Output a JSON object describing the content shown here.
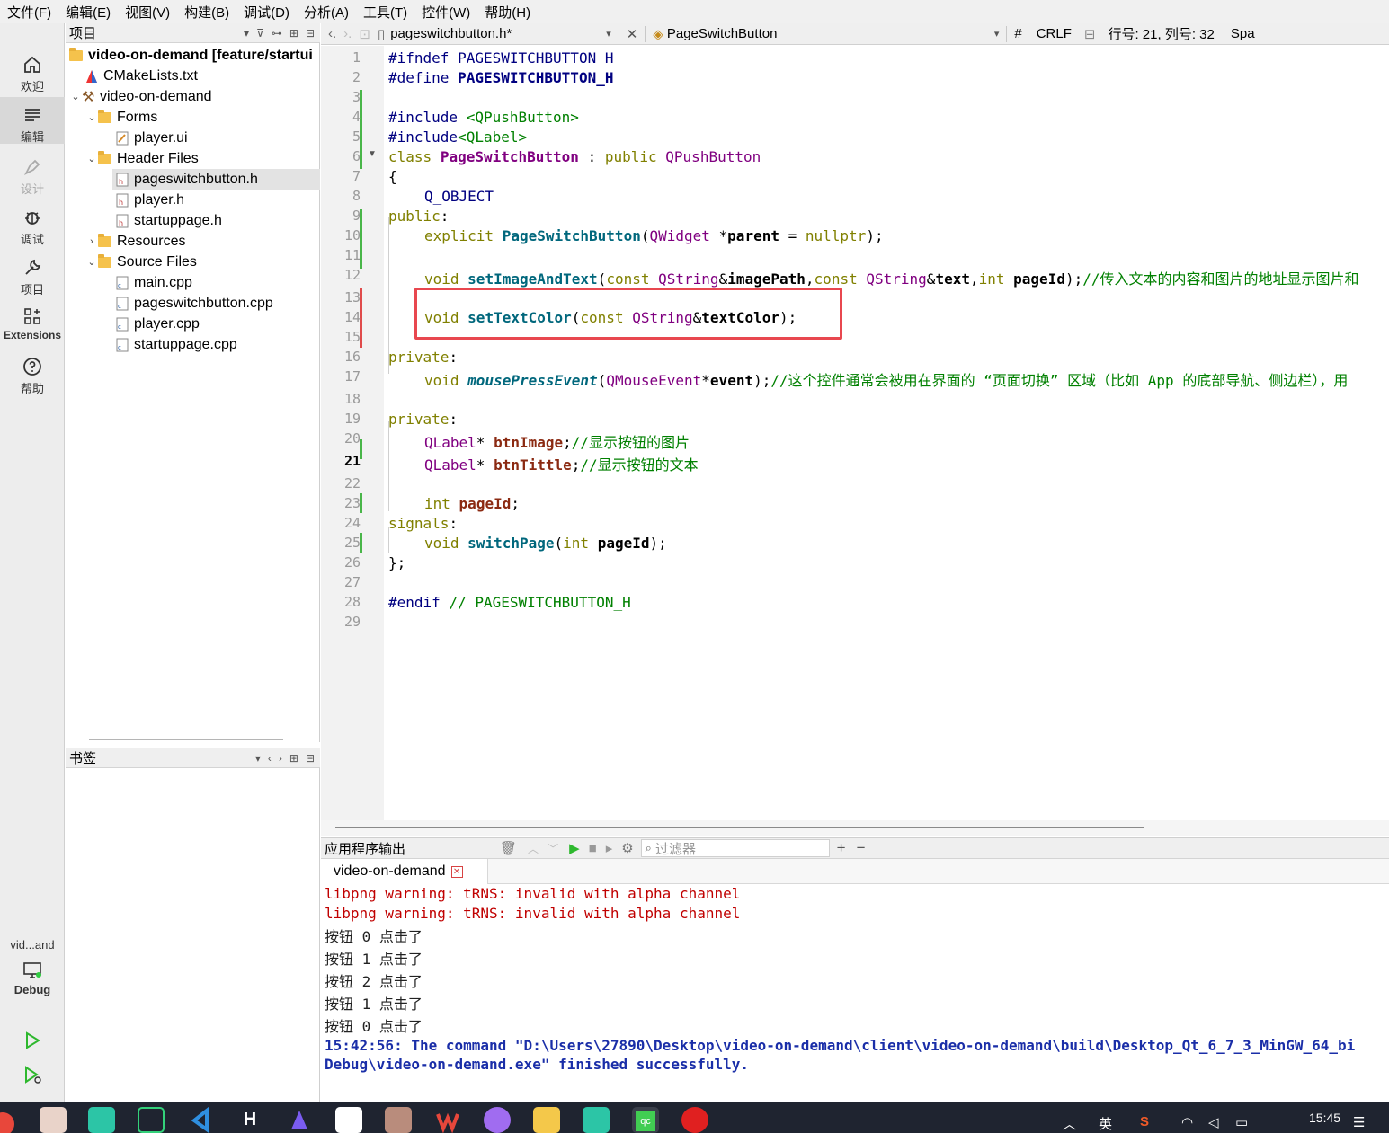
{
  "menu": [
    "文件(F)",
    "编辑(E)",
    "视图(V)",
    "构建(B)",
    "调试(D)",
    "分析(A)",
    "工具(T)",
    "控件(W)",
    "帮助(H)"
  ],
  "modes": {
    "welcome": "欢迎",
    "edit": "编辑",
    "design": "设计",
    "debug": "调试",
    "project": "项目",
    "extensions": "Extensions",
    "help": "帮助",
    "target_name": "vid...and",
    "target_config": "Debug"
  },
  "project_panel": {
    "title": "项目",
    "tree": [
      {
        "label": "video-on-demand [feature/startui",
        "bold": true
      },
      {
        "label": "CMakeLists.txt"
      },
      {
        "label": "video-on-demand"
      },
      {
        "label": "Forms"
      },
      {
        "label": "player.ui"
      },
      {
        "label": "Header Files"
      },
      {
        "label": "pageswitchbutton.h"
      },
      {
        "label": "player.h"
      },
      {
        "label": "startuppage.h"
      },
      {
        "label": "Resources"
      },
      {
        "label": "Source Files"
      },
      {
        "label": "main.cpp"
      },
      {
        "label": "pageswitchbutton.cpp"
      },
      {
        "label": "player.cpp"
      },
      {
        "label": "startuppage.cpp"
      }
    ]
  },
  "bookmarks_panel": {
    "title": "书签"
  },
  "editor_toolbar": {
    "file_name": "pageswitchbutton.h*",
    "symbol": "PageSwitchButton",
    "hash": "#",
    "line_ending": "CRLF",
    "position": "行号: 21, 列号: 32",
    "indent": "Spa"
  },
  "code": {
    "current_line": 21,
    "line_numbers": [
      "1",
      "2",
      "3",
      "4",
      "5",
      "6",
      "7",
      "8",
      "9",
      "10",
      "11",
      "12",
      "13",
      "14",
      "15",
      "16",
      "17",
      "18",
      "19",
      "20",
      "21",
      "22",
      "23",
      "24",
      "25",
      "26",
      "27",
      "28",
      "29"
    ],
    "l1_kw": "#ifndef",
    "l1_macro": "PAGESWITCHBUTTON_H",
    "l2_kw": "#define",
    "l2_macro": "PAGESWITCHBUTTON_H",
    "l4_kw": "#include",
    "l4_inc": "<QPushButton>",
    "l5_kw": "#include",
    "l5_inc": "<QLabel>",
    "l6_class": "class",
    "l6_name": "PageSwitchButton",
    "l6_colon": " : ",
    "l6_public": "public",
    "l6_base": "QPushButton",
    "l7": "{",
    "l8": "Q_OBJECT",
    "l9": "public",
    "l9_colon": ":",
    "l10_explicit": "explicit",
    "l10_fn": "PageSwitchButton",
    "l10_type": "QWidget",
    "l10_param": "parent",
    "l10_null": "nullptr",
    "l12_void": "void",
    "l12_fn": "setImageAndText",
    "l12_const": "const",
    "l12_type": "QString",
    "l12_p1": "imagePath",
    "l12_p2": "text",
    "l12_int": "int",
    "l12_p3": "pageId",
    "l12_cm": "//传入文本的内容和图片的地址显示图片和",
    "l14_void": "void",
    "l14_fn": "setTextColor",
    "l14_const": "const",
    "l14_type": "QString",
    "l14_p": "textColor",
    "l16": "private",
    "l17_void": "void",
    "l17_fn": "mousePressEvent",
    "l17_type": "QMouseEvent",
    "l17_p": "event",
    "l17_cm": "//这个控件通常会被用在界面的 “页面切换” 区域（比如 App 的底部导航、侧边栏），用",
    "l19": "private",
    "l20_type": "QLabel",
    "l20_p": "btnImage",
    "l20_cm": "//显示按钮的图片",
    "l21_type": "QLabel",
    "l21_p": "btnTittle",
    "l21_cm": "//显示按钮的文本",
    "l23_int": "int",
    "l23_p": "pageId",
    "l24": "signals",
    "l25_void": "void",
    "l25_fn": "switchPage",
    "l25_int": "int",
    "l25_p": "pageId",
    "l26": "};",
    "l28_kw": "#endif",
    "l28_cm": "// PAGESWITCHBUTTON_H"
  },
  "output": {
    "title": "应用程序输出",
    "filter_placeholder": "过滤器",
    "tab": "video-on-demand",
    "lines": [
      "libpng warning: tRNS: invalid with alpha channel",
      "libpng warning: tRNS: invalid with alpha channel",
      "按钮 0 点击了",
      "按钮 1 点击了",
      "按钮 2 点击了",
      "按钮 1 点击了",
      "按钮 0 点击了",
      "15:42:56: The command \"D:\\Users\\27890\\Desktop\\video-on-demand\\client\\video-on-demand\\build\\Desktop_Qt_6_7_3_MinGW_64_bi",
      "Debug\\video-on-demand.exe\" finished successfully."
    ]
  },
  "taskbar": {
    "ime": "英",
    "clock": "15:45"
  },
  "colors": {
    "highlight_box": "#e8474f",
    "keyword": "#808000",
    "preprocessor": "#000080",
    "type": "#800080",
    "function": "#00677c",
    "comment": "#008000",
    "warning": "#c00000",
    "info": "#1a2ea8"
  }
}
